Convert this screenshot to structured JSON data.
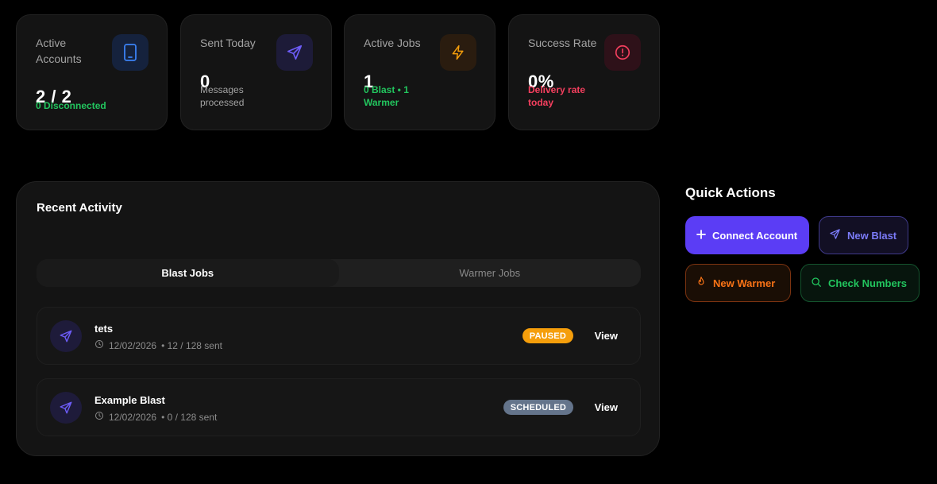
{
  "stats": [
    {
      "label": "Active Accounts",
      "value": "2 / 2",
      "sub": "0 Disconnected",
      "sub_color": "#22c55e",
      "icon": "phone-icon",
      "accent": "#3b82f6"
    },
    {
      "label": "Sent Today",
      "value": "0",
      "sub": "Messages processed",
      "sub_color": "#a3a3a3",
      "icon": "send-icon",
      "accent": "#6d5cf7"
    },
    {
      "label": "Active Jobs",
      "value": "1",
      "sub": "0 Blast • 1 Warmer",
      "sub_color": "#22c55e",
      "icon": "lightning-icon",
      "accent": "#f59e0b"
    },
    {
      "label": "Success Rate",
      "value": "0%",
      "sub": "Delivery rate today",
      "sub_color": "#f43f5e",
      "icon": "alert-circle-icon",
      "accent": "#f43f5e"
    }
  ],
  "activity": {
    "title": "Recent Activity",
    "tabs": [
      "Blast Jobs",
      "Warmer Jobs"
    ],
    "active_tab": "Blast Jobs",
    "rows": [
      {
        "name": "tets",
        "date": "12/02/2026",
        "progress": "• 12 / 128 sent",
        "status": "PAUSED",
        "status_color": "#f59e0b",
        "view_label": "View"
      },
      {
        "name": "Example Blast",
        "date": "12/02/2026",
        "progress": "• 0 / 128 sent",
        "status": "SCHEDULED",
        "status_color": "#64748b",
        "view_label": "View"
      }
    ]
  },
  "quick_actions": {
    "title": "Quick Actions",
    "buttons": [
      {
        "label": "Connect Account",
        "icon": "plus-icon",
        "color": "#5b3df5"
      },
      {
        "label": "New Blast",
        "icon": "send-icon",
        "color": "#6d6cf7"
      },
      {
        "label": "New Warmer",
        "icon": "flame-icon",
        "color": "#f97316"
      },
      {
        "label": "Check Numbers",
        "icon": "search-icon",
        "color": "#22c55e"
      }
    ]
  }
}
